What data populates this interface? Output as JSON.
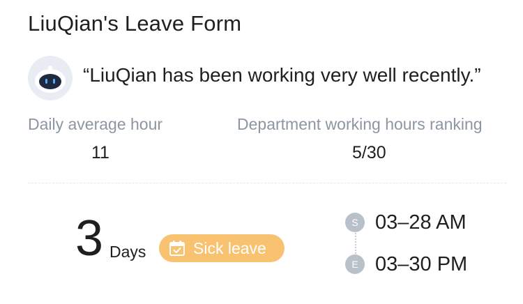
{
  "title": "LiuQian's Leave Form",
  "quote": "“LiuQian has been working very well recently.”",
  "stats": {
    "daily_average": {
      "label": "Daily average hour",
      "value": "11"
    },
    "ranking": {
      "label": "Department working hours ranking",
      "value": "5/30"
    }
  },
  "leave": {
    "days_count": "3",
    "days_label": "Days",
    "type_label": "Sick leave"
  },
  "schedule": {
    "start": {
      "marker": "S",
      "value": "03–28 AM"
    },
    "end": {
      "marker": "E",
      "value": "03–30 PM"
    }
  },
  "colors": {
    "badge": "#f8c270",
    "muted_text": "#8c96a3",
    "timeline_dot": "#b8c0c9",
    "avatar_bg": "#e9edf3"
  },
  "icons": {
    "avatar": "robot-avatar-icon",
    "leave_type": "calendar-check-icon"
  }
}
